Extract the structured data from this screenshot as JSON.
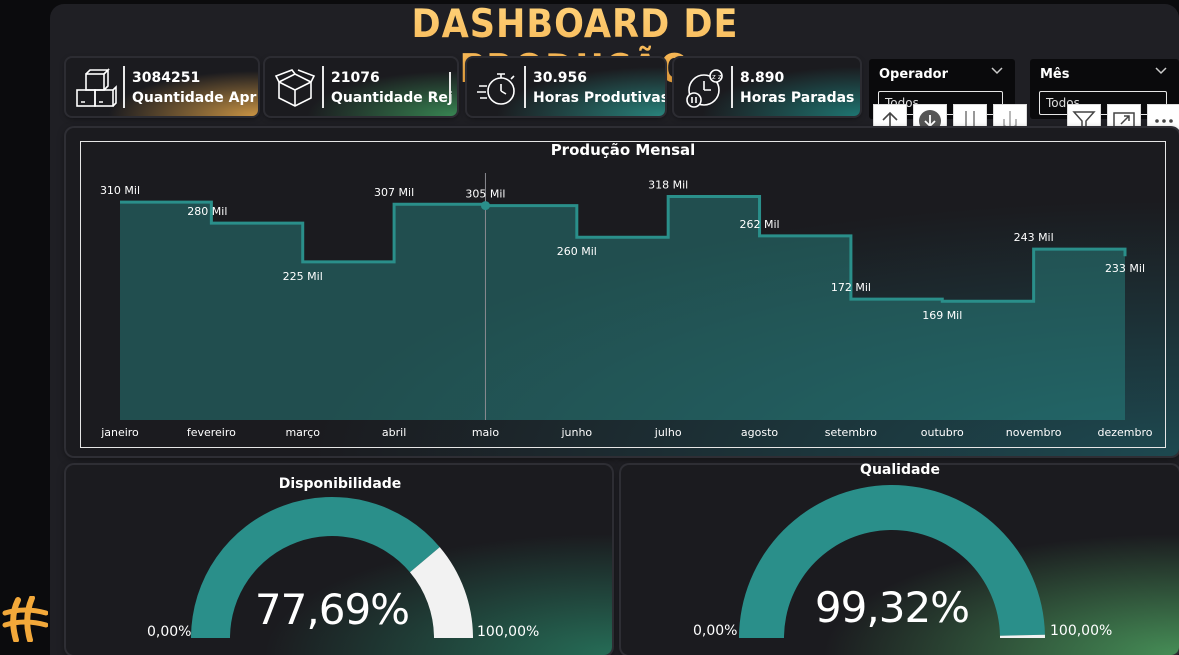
{
  "dashboard": {
    "title": "DASHBOARD DE PRODUÇÃO"
  },
  "kpis": [
    {
      "value": "3084251",
      "label": "Quantidade Apr",
      "icon": "boxes-icon",
      "accent": "#e8a94a"
    },
    {
      "value": "21076",
      "label": "Quantidade Rej",
      "icon": "open-box-icon",
      "accent": "#3f8f5f"
    },
    {
      "value": "30.956",
      "label": "Horas Produtivas",
      "icon": "stopwatch-icon",
      "accent": "#2a8f86"
    },
    {
      "value": "8.890",
      "label": "Horas Paradas",
      "icon": "clock-pause-icon",
      "accent": "#1f7f7a"
    }
  ],
  "slicers": [
    {
      "title": "Operador",
      "value": "Todos"
    },
    {
      "title": "Mês",
      "value": "Todos"
    }
  ],
  "toolbar": [
    "drill-up-icon",
    "drill-down-toggle-icon",
    "expand-next-level-icon",
    "expand-hierarchy-icon",
    "filter-icon",
    "focus-mode-icon",
    "more-options-icon"
  ],
  "chart_data": {
    "type": "area",
    "title": "Produção Mensal",
    "step": true,
    "categories": [
      "janeiro",
      "fevereiro",
      "março",
      "abril",
      "maio",
      "junho",
      "julho",
      "agosto",
      "setembro",
      "outubro",
      "novembro",
      "dezembro"
    ],
    "values": [
      310,
      280,
      225,
      307,
      305,
      260,
      318,
      262,
      172,
      169,
      243,
      233
    ],
    "data_labels": [
      "310 Mil",
      "280 Mil",
      "225 Mil",
      "307 Mil",
      "305 Mil",
      "260 Mil",
      "318 Mil",
      "262 Mil",
      "172 Mil",
      "169 Mil",
      "243 Mil",
      "233 Mil"
    ],
    "unit": "Mil",
    "ylim": [
      0,
      340
    ],
    "highlighted": "maio",
    "color": "#2a8f8a",
    "grid": false
  },
  "gauges": [
    {
      "title": "Disponibilidade",
      "value": 0.7769,
      "display": "77,69%",
      "min": "0,00%",
      "max": "100,00%"
    },
    {
      "title": "Qualidade",
      "value": 0.9932,
      "display": "99,32%",
      "min": "0,00%",
      "max": "100,00%"
    }
  ],
  "colors": {
    "accent": "#2a8f8a",
    "title": "#f3b24e",
    "gauge_remainder": "#f2f2f2"
  }
}
